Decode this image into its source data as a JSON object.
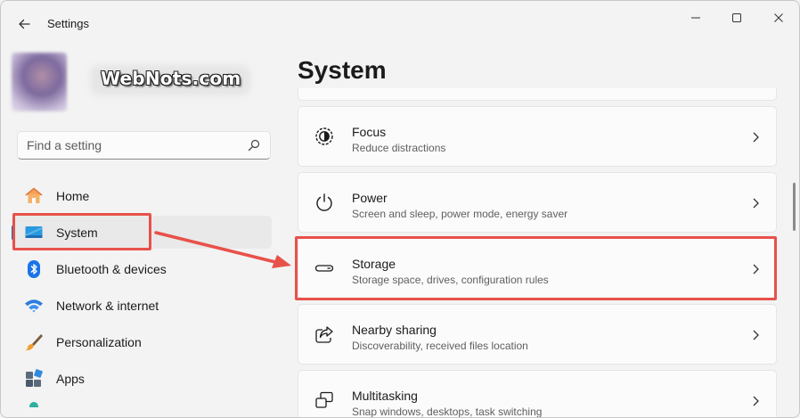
{
  "window": {
    "title": "Settings"
  },
  "profile": {
    "watermark": "WebNots.com"
  },
  "search": {
    "placeholder": "Find a setting"
  },
  "nav": {
    "items": [
      {
        "label": "Home",
        "icon": "home-icon"
      },
      {
        "label": "System",
        "icon": "system-icon",
        "active": true
      },
      {
        "label": "Bluetooth & devices",
        "icon": "bluetooth-icon"
      },
      {
        "label": "Network & internet",
        "icon": "wifi-icon"
      },
      {
        "label": "Personalization",
        "icon": "brush-icon"
      },
      {
        "label": "Apps",
        "icon": "apps-icon"
      }
    ]
  },
  "main": {
    "title": "System",
    "cards": [
      {
        "title": "Focus",
        "desc": "Reduce distractions",
        "icon": "focus-icon"
      },
      {
        "title": "Power",
        "desc": "Screen and sleep, power mode, energy saver",
        "icon": "power-icon"
      },
      {
        "title": "Storage",
        "desc": "Storage space, drives, configuration rules",
        "icon": "storage-icon"
      },
      {
        "title": "Nearby sharing",
        "desc": "Discoverability, received files location",
        "icon": "share-icon"
      },
      {
        "title": "Multitasking",
        "desc": "Snap windows, desktops, task switching",
        "icon": "multitasking-icon"
      }
    ]
  },
  "colors": {
    "accent": "#0067c0",
    "annotation": "#e8514a",
    "background": "#f3f3f3",
    "card": "#fbfbfb"
  }
}
